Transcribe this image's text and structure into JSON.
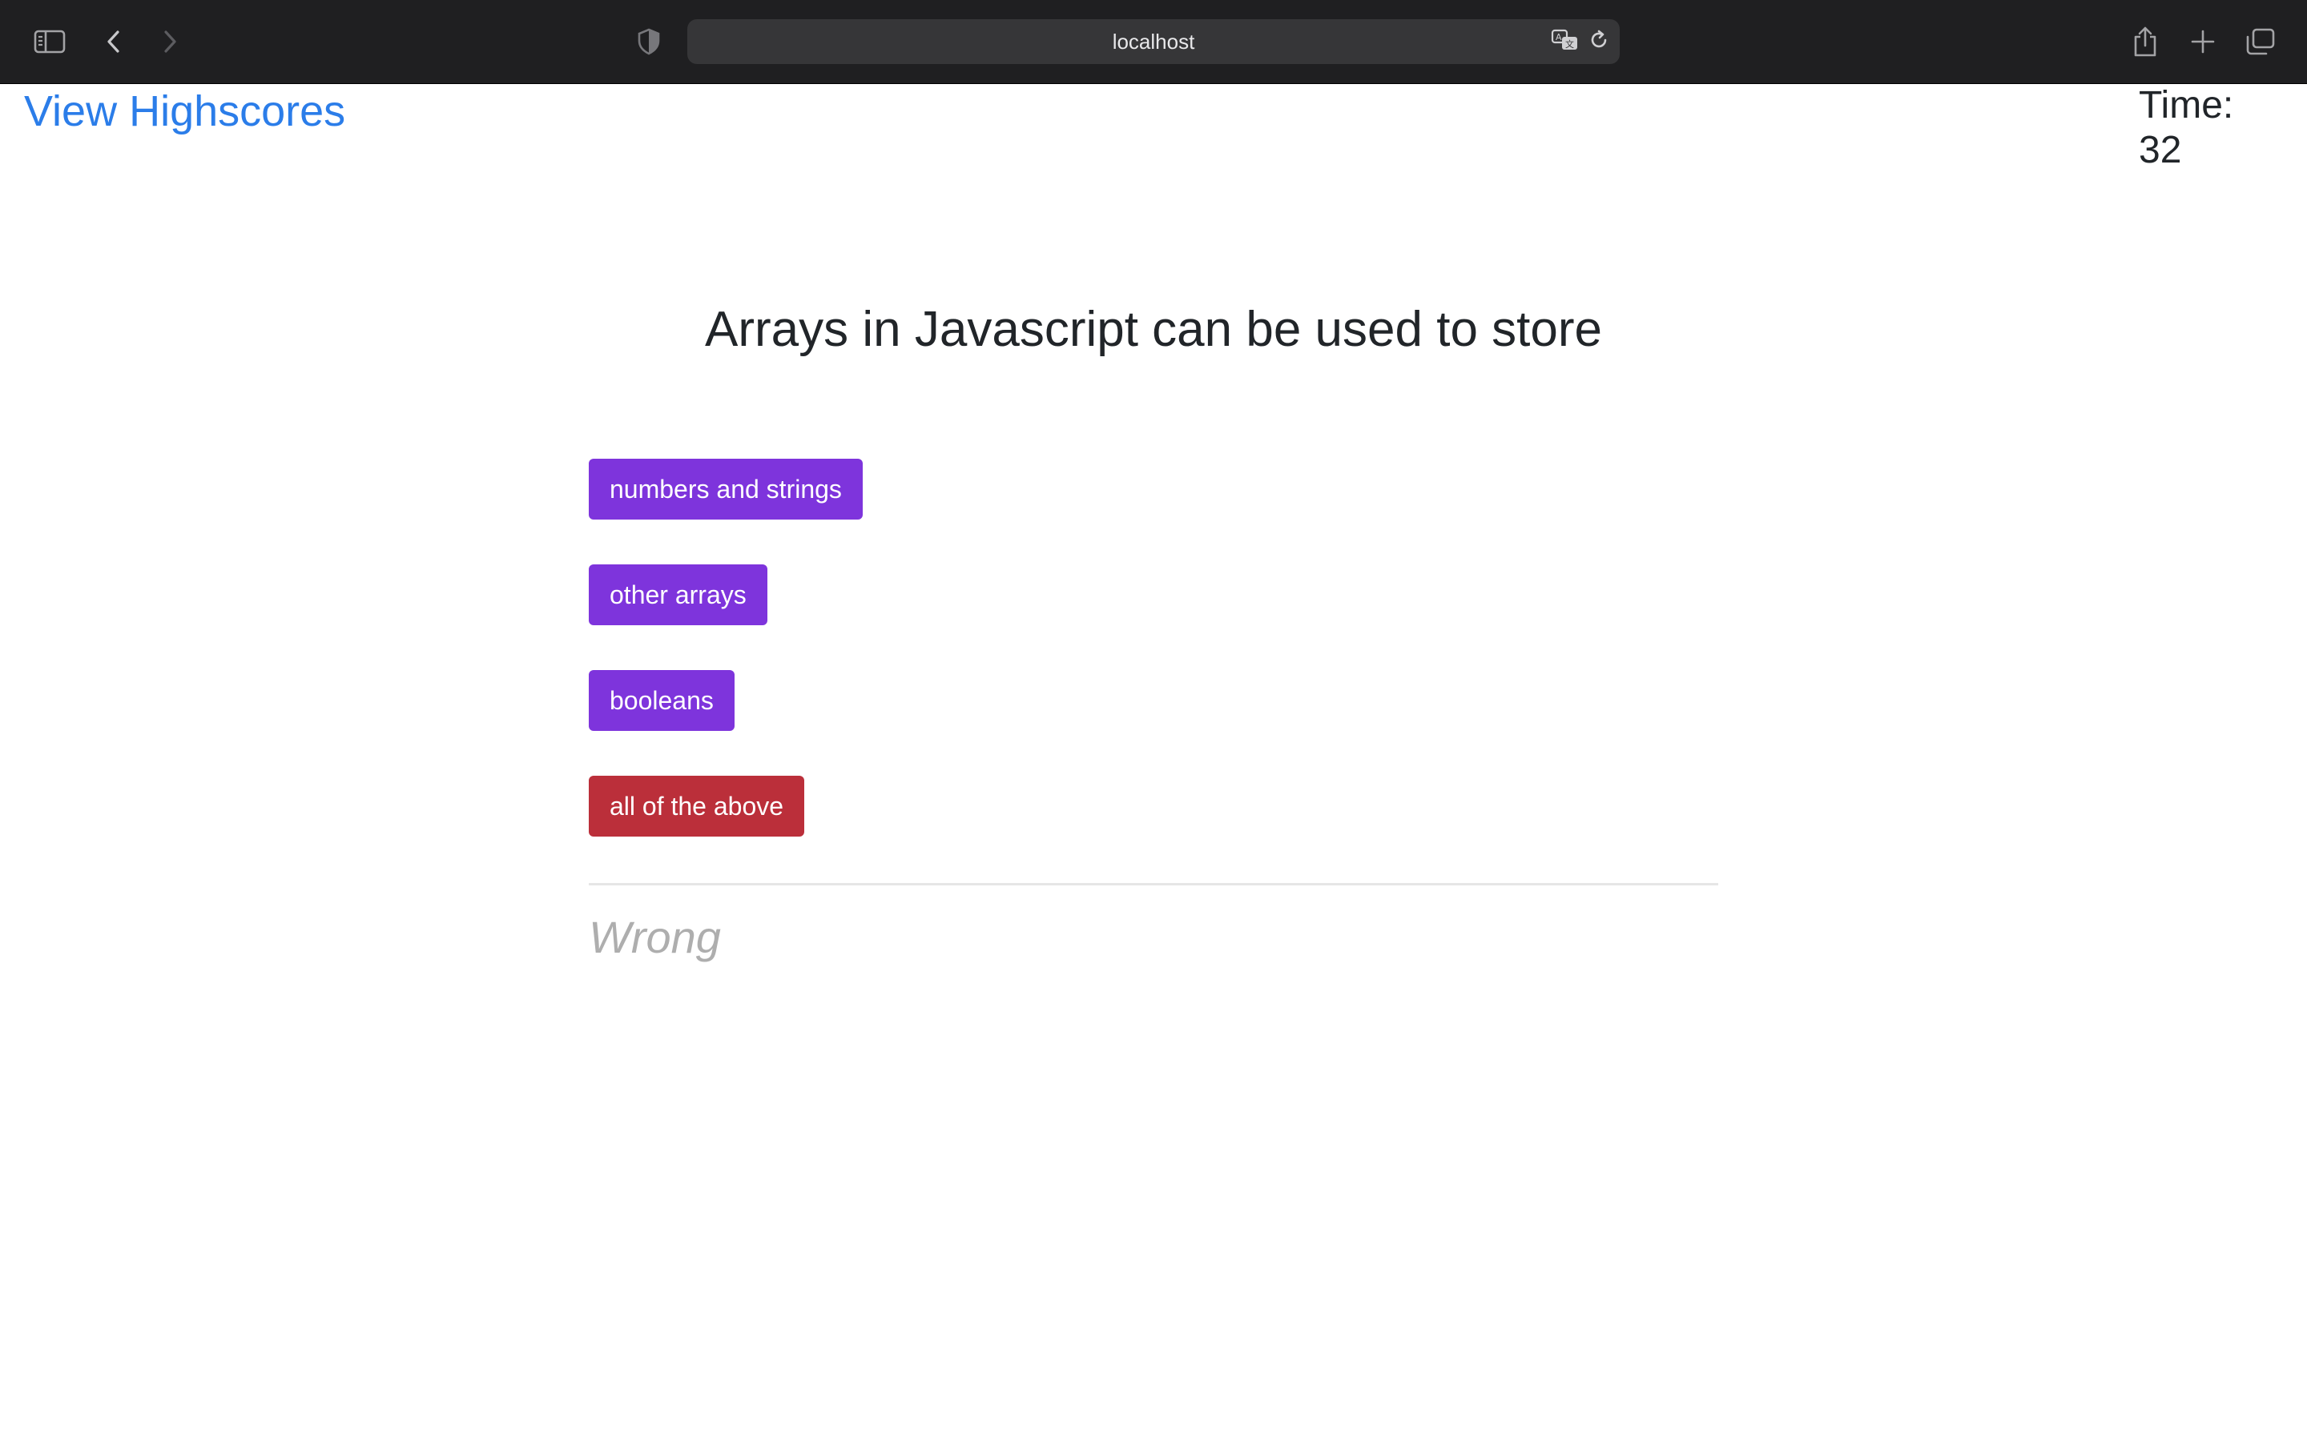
{
  "browser": {
    "url": "localhost",
    "icons": {
      "sidebar": "sidebar-toggle-icon",
      "back": "chevron-left-icon",
      "forward": "chevron-right-icon",
      "privacy": "shield-icon",
      "translate": "translate-icon",
      "reload": "reload-icon",
      "share": "share-icon",
      "new_tab": "plus-icon",
      "tabs": "tab-overview-icon"
    }
  },
  "header": {
    "highscores_link": "View Highscores",
    "timer_label": "Time:",
    "timer_value": "32"
  },
  "quiz": {
    "question": "Arrays in Javascript can be used to store",
    "answers": [
      {
        "label": "numbers and strings",
        "state": "default"
      },
      {
        "label": "other arrays",
        "state": "default"
      },
      {
        "label": "booleans",
        "state": "default"
      },
      {
        "label": "all of the above",
        "state": "wrong"
      }
    ],
    "feedback": "Wrong"
  },
  "colors": {
    "answer_default": "#7e34dc",
    "answer_wrong": "#bb2f3a",
    "link": "#2b7de9",
    "feedback": "#aeaeae"
  }
}
